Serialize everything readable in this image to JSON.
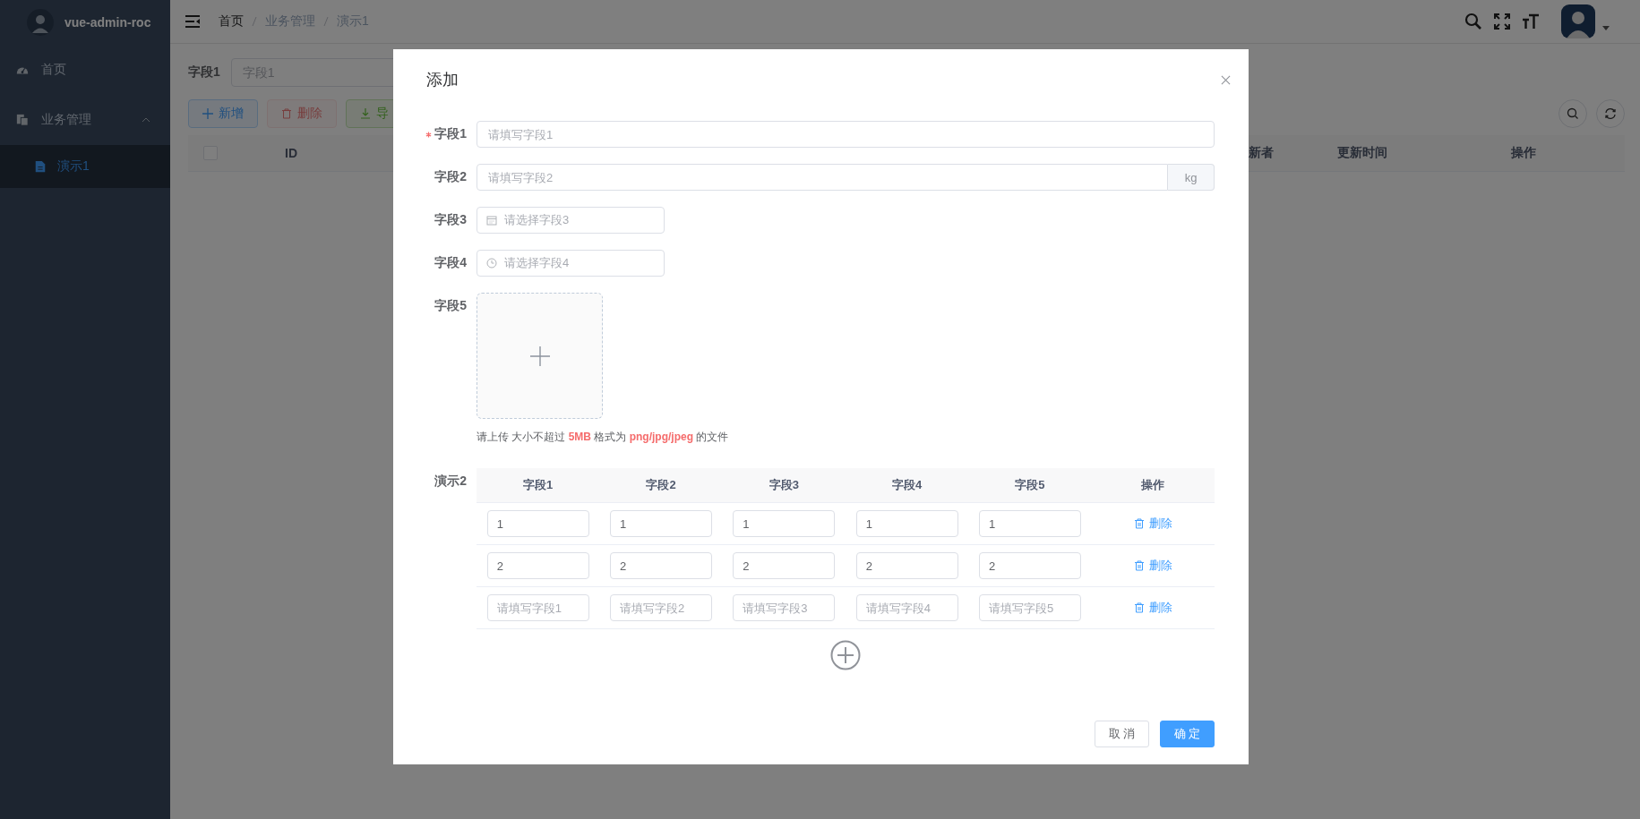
{
  "sidebar": {
    "logo_text": "vue-admin-roc",
    "menu": [
      {
        "label": "首页"
      },
      {
        "label": "业务管理",
        "expanded": true,
        "children": [
          {
            "label": "演示1",
            "selected": true
          }
        ]
      }
    ]
  },
  "header": {
    "breadcrumb": [
      "首页",
      "业务管理",
      "演示1"
    ]
  },
  "page": {
    "search": {
      "label": "字段1",
      "placeholder": "字段1"
    },
    "toolbar": [
      {
        "label": "新增",
        "kind": "primary",
        "disabled": false
      },
      {
        "label": "删除",
        "kind": "danger",
        "disabled": true
      },
      {
        "label": "导",
        "kind": "success",
        "disabled": false
      }
    ],
    "table": {
      "select_all": {
        "checked": false
      },
      "columns_left": [
        "ID"
      ],
      "columns_right": [
        "新者",
        "更新时间",
        "操作"
      ]
    }
  },
  "dialog": {
    "title": "添加",
    "fields": [
      {
        "label": "字段1",
        "required": true,
        "kind": "input",
        "placeholder": "请填写字段1"
      },
      {
        "label": "字段2",
        "kind": "input",
        "placeholder": "请填写字段2",
        "append": "kg"
      },
      {
        "label": "字段3",
        "kind": "date",
        "placeholder": "请选择字段3"
      },
      {
        "label": "字段4",
        "kind": "time",
        "placeholder": "请选择字段4"
      },
      {
        "label": "字段5",
        "kind": "upload",
        "hint": "请上传 大小不超过 **5MB** 格式为 **png/jpg/jpeg** 的文件"
      }
    ],
    "demo2": {
      "label": "演示2",
      "columns": [
        "字段1",
        "字段2",
        "字段3",
        "字段4",
        "字段5",
        "操作"
      ],
      "rows": [
        {
          "cells": [
            {
              "value": "1"
            },
            {
              "value": "1"
            },
            {
              "value": "1"
            },
            {
              "value": "1"
            },
            {
              "value": "1"
            }
          ],
          "action": "删除"
        },
        {
          "cells": [
            {
              "value": "2"
            },
            {
              "value": "2"
            },
            {
              "value": "2"
            },
            {
              "value": "2"
            },
            {
              "value": "2"
            }
          ],
          "action": "删除"
        },
        {
          "cells": [
            {
              "placeholder": "请填写字段1"
            },
            {
              "placeholder": "请填写字段2"
            },
            {
              "placeholder": "请填写字段3"
            },
            {
              "placeholder": "请填写字段4"
            },
            {
              "placeholder": "请填写字段5"
            }
          ],
          "action": "删除"
        }
      ]
    },
    "buttons": [
      {
        "label": "取 消",
        "kind": "default"
      },
      {
        "label": "确 定",
        "kind": "primary"
      }
    ]
  }
}
